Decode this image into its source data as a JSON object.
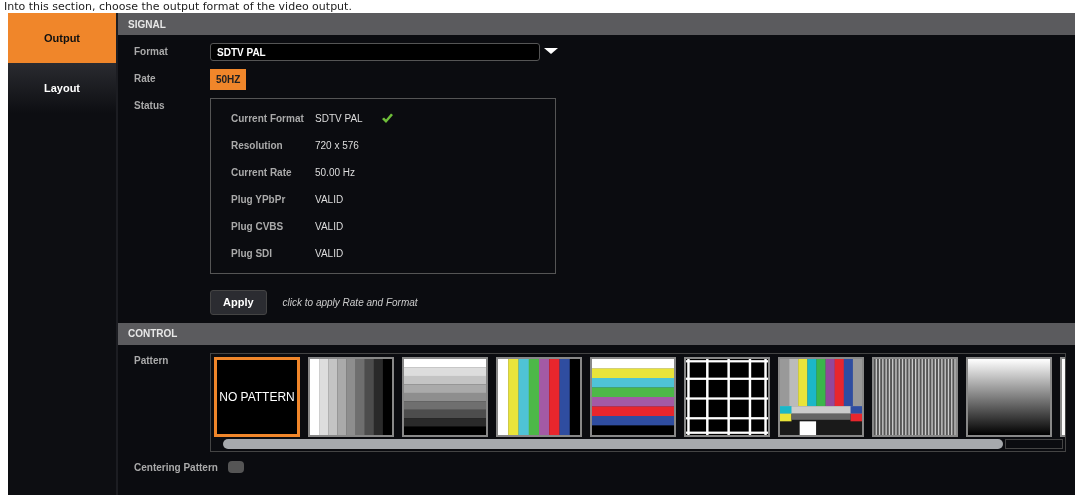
{
  "caption": "Into this section, choose the output format of the video output.",
  "sidebar": {
    "items": [
      {
        "label": "Output",
        "selected": true
      },
      {
        "label": "Layout",
        "selected": false
      }
    ]
  },
  "signal": {
    "title": "SIGNAL",
    "format": {
      "label": "Format",
      "value": "SDTV PAL"
    },
    "rate": {
      "label": "Rate",
      "value": "50HZ"
    },
    "status": {
      "label": "Status",
      "rows": [
        {
          "label": "Current Format",
          "value": "SDTV PAL",
          "ok": true
        },
        {
          "label": "Resolution",
          "value": "720 x 576",
          "ok": false
        },
        {
          "label": "Current Rate",
          "value": "50.00 Hz",
          "ok": false
        },
        {
          "label": "Plug YPbPr",
          "value": "VALID",
          "ok": false
        },
        {
          "label": "Plug CVBS",
          "value": "VALID",
          "ok": false
        },
        {
          "label": "Plug SDI",
          "value": "VALID",
          "ok": false
        }
      ]
    },
    "apply": {
      "button": "Apply",
      "hint": "click to apply Rate and Format"
    }
  },
  "control": {
    "title": "CONTROL",
    "pattern": {
      "label": "Pattern",
      "items": [
        {
          "kind": "none",
          "text": "NO PATTERN",
          "selected": true
        },
        {
          "kind": "vsteps",
          "selected": false
        },
        {
          "kind": "hsteps",
          "selected": false
        },
        {
          "kind": "vbars",
          "selected": false
        },
        {
          "kind": "hbars",
          "selected": false
        },
        {
          "kind": "grid",
          "selected": false
        },
        {
          "kind": "testcard",
          "selected": false
        },
        {
          "kind": "lines",
          "selected": false
        },
        {
          "kind": "gradient",
          "selected": false
        },
        {
          "kind": "partial",
          "selected": false
        }
      ]
    },
    "centering": {
      "label": "Centering Pattern",
      "checked": false
    }
  }
}
